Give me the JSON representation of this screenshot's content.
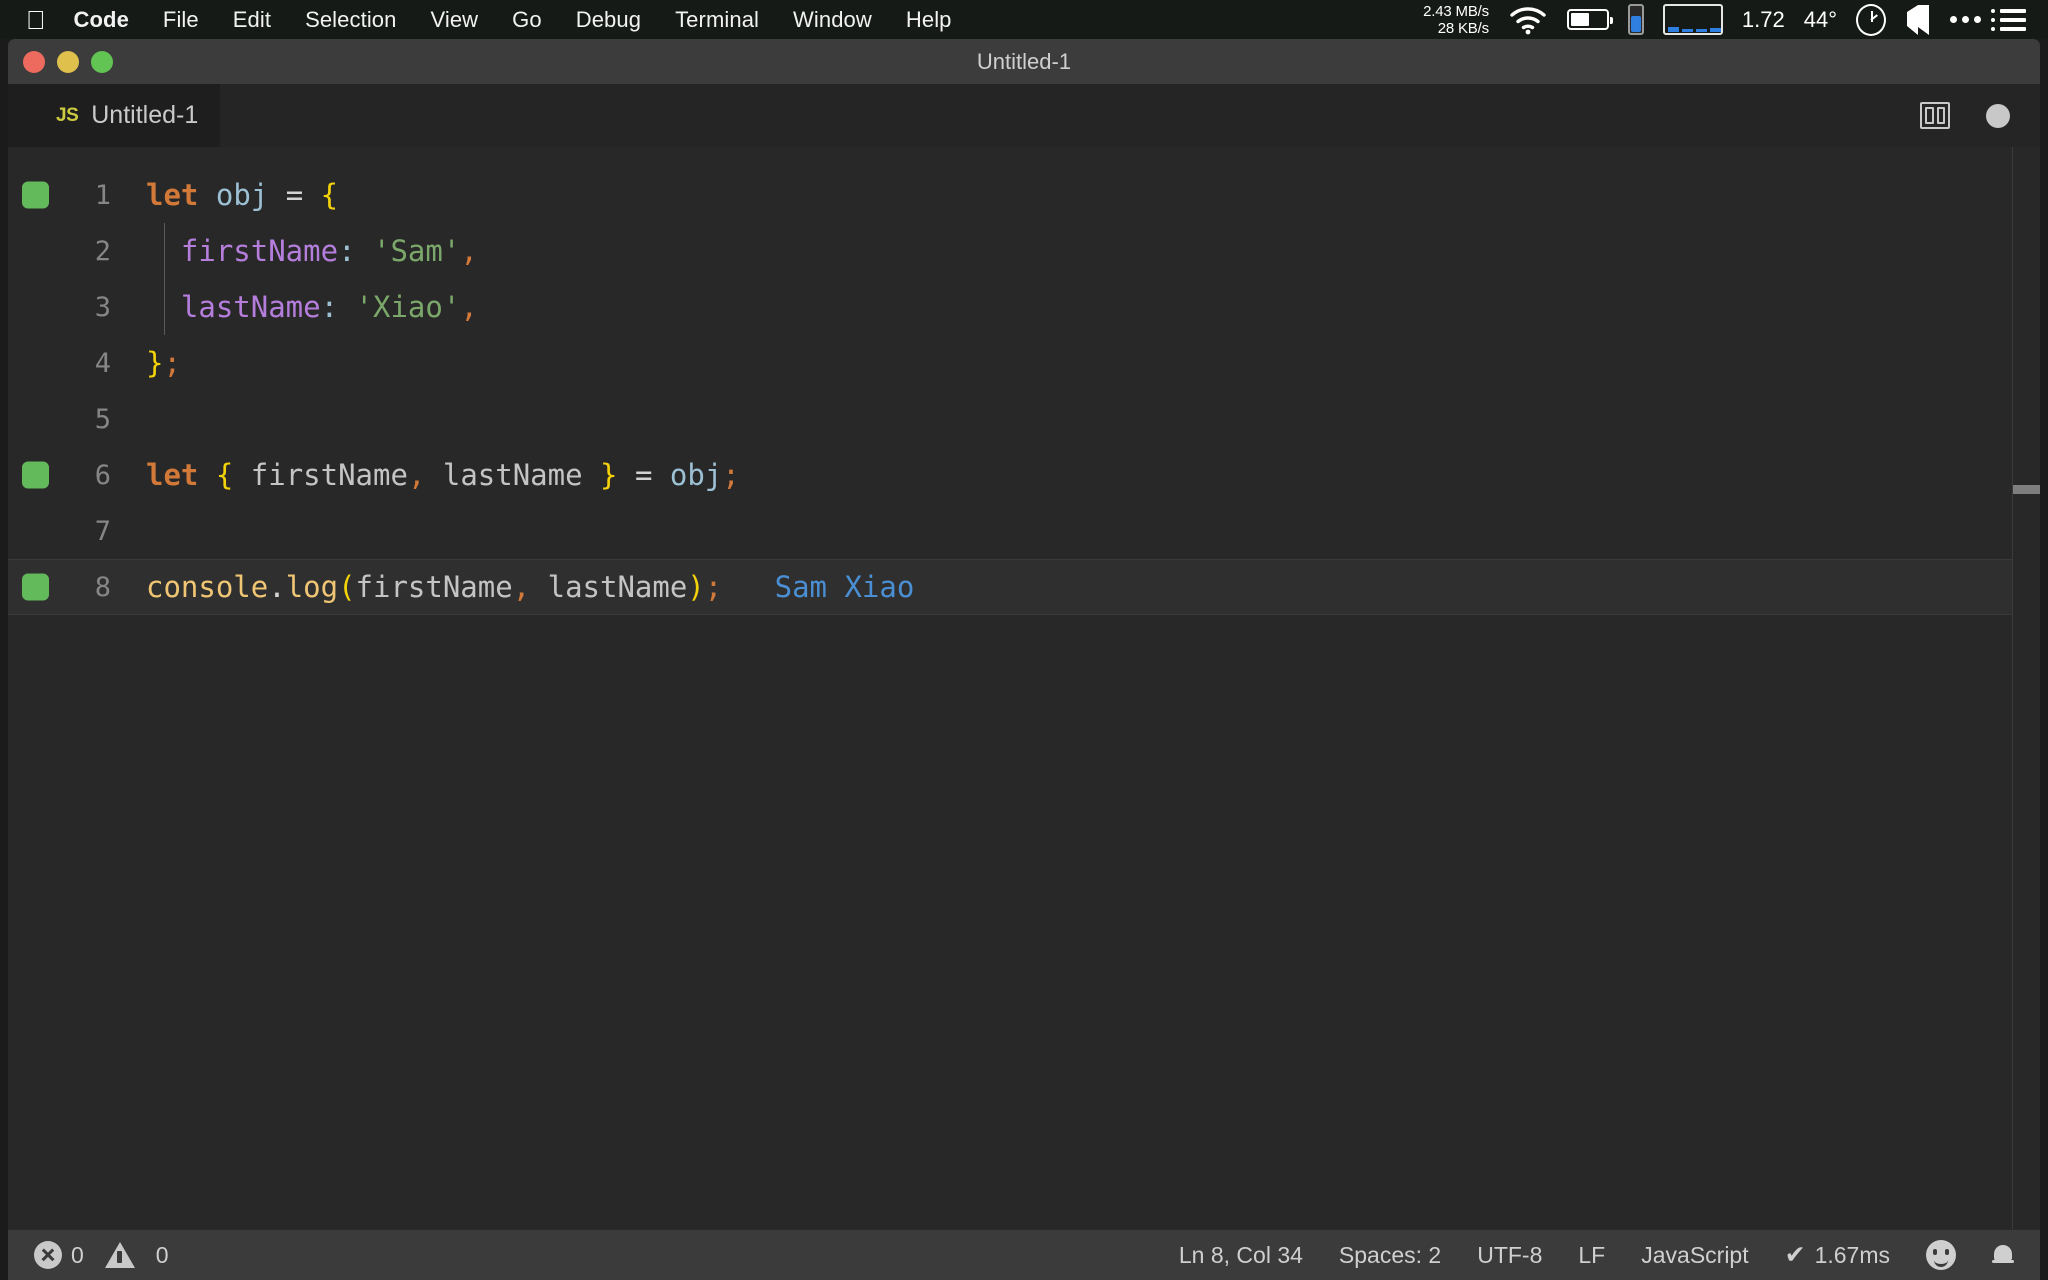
{
  "menubar": {
    "apple_icon": "apple-logo-icon",
    "items": [
      {
        "label": "Code",
        "active": true
      },
      {
        "label": "File",
        "active": false
      },
      {
        "label": "Edit",
        "active": false
      },
      {
        "label": "Selection",
        "active": false
      },
      {
        "label": "View",
        "active": false
      },
      {
        "label": "Go",
        "active": false
      },
      {
        "label": "Debug",
        "active": false
      },
      {
        "label": "Terminal",
        "active": false
      },
      {
        "label": "Window",
        "active": false
      },
      {
        "label": "Help",
        "active": false
      }
    ],
    "status": {
      "net_down": "2.43 MB/s",
      "net_up": "28 KB/s",
      "wifi_icon": "wifi-icon",
      "battery_icon": "battery-icon",
      "gauge_icon": "memory-gauge-icon",
      "graph_icon": "cpu-graph-icon",
      "load": "1.72",
      "temperature": "44°",
      "clock_icon": "clock-icon",
      "shield_icon": "shield-icon",
      "more_icon": "ellipsis-icon",
      "list_icon": "list-icon"
    }
  },
  "window": {
    "title": "Untitled-1",
    "traffic": {
      "close": "close-button",
      "minimize": "minimize-button",
      "maximize": "maximize-button"
    }
  },
  "tab": {
    "file_type_icon": "JS",
    "label": "Untitled-1",
    "split_icon": "split-editor-icon",
    "dirty_indicator": "unsaved-dot-icon"
  },
  "editor": {
    "lines": [
      {
        "number": "1",
        "marker": true,
        "current": false,
        "indent_guide": false,
        "tokens": [
          {
            "t": "let",
            "c": "t-key"
          },
          {
            "t": " ",
            "c": "t-op"
          },
          {
            "t": "obj",
            "c": "t-var"
          },
          {
            "t": " = ",
            "c": "t-op"
          },
          {
            "t": "{",
            "c": "t-brace"
          }
        ]
      },
      {
        "number": "2",
        "marker": false,
        "current": false,
        "indent_guide": true,
        "tokens": [
          {
            "t": "  ",
            "c": "t-op"
          },
          {
            "t": "firstName",
            "c": "t-prop"
          },
          {
            "t": ":",
            "c": "t-colon"
          },
          {
            "t": " ",
            "c": "t-op"
          },
          {
            "t": "'Sam'",
            "c": "t-str"
          },
          {
            "t": ",",
            "c": "t-comma"
          }
        ]
      },
      {
        "number": "3",
        "marker": false,
        "current": false,
        "indent_guide": true,
        "tokens": [
          {
            "t": "  ",
            "c": "t-op"
          },
          {
            "t": "lastName",
            "c": "t-prop"
          },
          {
            "t": ":",
            "c": "t-colon"
          },
          {
            "t": " ",
            "c": "t-op"
          },
          {
            "t": "'Xiao'",
            "c": "t-str"
          },
          {
            "t": ",",
            "c": "t-comma"
          }
        ]
      },
      {
        "number": "4",
        "marker": false,
        "current": false,
        "indent_guide": false,
        "tokens": [
          {
            "t": "}",
            "c": "t-brace"
          },
          {
            "t": ";",
            "c": "t-comma"
          }
        ]
      },
      {
        "number": "5",
        "marker": false,
        "current": false,
        "indent_guide": false,
        "tokens": []
      },
      {
        "number": "6",
        "marker": true,
        "current": false,
        "indent_guide": false,
        "tokens": [
          {
            "t": "let",
            "c": "t-key"
          },
          {
            "t": " ",
            "c": "t-op"
          },
          {
            "t": "{",
            "c": "t-brace"
          },
          {
            "t": " firstName",
            "c": "t-param"
          },
          {
            "t": ",",
            "c": "t-comma"
          },
          {
            "t": " lastName ",
            "c": "t-param"
          },
          {
            "t": "}",
            "c": "t-brace"
          },
          {
            "t": " = ",
            "c": "t-op"
          },
          {
            "t": "obj",
            "c": "t-var"
          },
          {
            "t": ";",
            "c": "t-comma"
          }
        ]
      },
      {
        "number": "7",
        "marker": false,
        "current": false,
        "indent_guide": false,
        "tokens": []
      },
      {
        "number": "8",
        "marker": true,
        "current": true,
        "indent_guide": false,
        "tokens": [
          {
            "t": "console",
            "c": "t-obj"
          },
          {
            "t": ".",
            "c": "t-op"
          },
          {
            "t": "log",
            "c": "t-fn"
          },
          {
            "t": "(",
            "c": "t-paren"
          },
          {
            "t": "firstName",
            "c": "t-param"
          },
          {
            "t": ",",
            "c": "t-comma"
          },
          {
            "t": " lastName",
            "c": "t-param"
          },
          {
            "t": ")",
            "c": "t-paren"
          },
          {
            "t": ";",
            "c": "t-comma"
          },
          {
            "t": "   ",
            "c": "t-op"
          },
          {
            "t": "Sam Xiao",
            "c": "t-result"
          }
        ]
      }
    ]
  },
  "statusbar": {
    "errors_icon": "error-icon",
    "errors": "0",
    "warnings_icon": "warning-icon",
    "warnings": "0",
    "cursor": "Ln 8, Col 34",
    "indent": "Spaces: 2",
    "encoding": "UTF-8",
    "eol": "LF",
    "language": "JavaScript",
    "runtime_check": "✔",
    "runtime": "1.67ms",
    "feedback_icon": "smiley-icon",
    "notifications_icon": "bell-icon"
  },
  "colors": {
    "accent_green": "#63ba5a",
    "keyword": "#d2793a",
    "string": "#7ba86a",
    "property": "#b57edc",
    "brace": "#f4d20a",
    "result": "#4a8fd4",
    "js_yellow": "#cbcb41"
  }
}
